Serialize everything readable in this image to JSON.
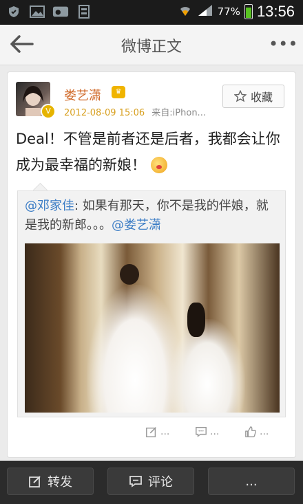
{
  "status_bar": {
    "battery_percent": "77%",
    "time": "13:56",
    "carrier_icon": "sina"
  },
  "header": {
    "title": "微博正文"
  },
  "post": {
    "username": "娄艺潇",
    "timestamp": "2012-08-09 15:06",
    "source": "来自:iPhon...",
    "favorite_label": "收藏",
    "text": "Deal！不管是前者还是后者，我都会让你成为最幸福的新娘！",
    "repost": {
      "mention_author": "@邓家佳",
      "body": ": 如果有那天，你不是我的伴娘，就是我的新郎。。。",
      "mention_tail": "@娄艺潇"
    },
    "actions": {
      "repost_count": "...",
      "comment_count": "...",
      "like_count": "..."
    }
  },
  "bottom_bar": {
    "repost_label": "转发",
    "comment_label": "评论",
    "more_label": "..."
  }
}
